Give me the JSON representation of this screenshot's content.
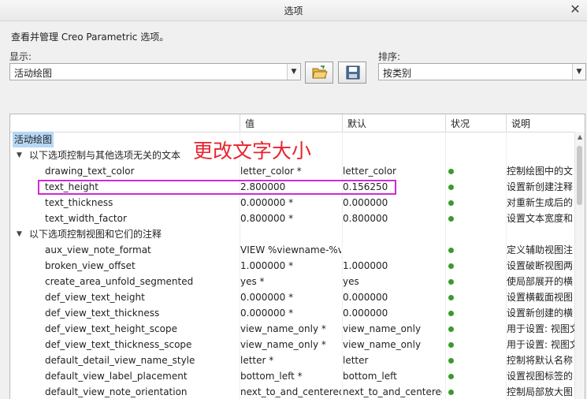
{
  "dialog": {
    "title": "选项",
    "close_glyph": "✕",
    "description": "查看并管理 Creo Parametric 选项。"
  },
  "display": {
    "label": "显示:",
    "value": "活动绘图",
    "arrow": "▼"
  },
  "sort": {
    "label": "排序:",
    "value": "按类别",
    "arrow": "▼"
  },
  "buttons": {
    "open_icon": "folder-open-icon",
    "save_icon": "save-disk-icon"
  },
  "table": {
    "headers": {
      "name": "",
      "value": "值",
      "default": "默认",
      "status": "状况",
      "description": "说明"
    },
    "category": "活动绘图",
    "groups": [
      {
        "label": "以下选项控制与其他选项无关的文本",
        "rows": [
          {
            "name": "drawing_text_color",
            "value": "letter_color *",
            "default": "letter_color",
            "desc": "控制绘图中的文"
          },
          {
            "name": "text_height",
            "value": "2.800000",
            "default": "0.156250",
            "desc": "设置新创建注释"
          },
          {
            "name": "text_thickness",
            "value": "0.000000 *",
            "default": "0.000000",
            "desc": "对重新生成后的"
          },
          {
            "name": "text_width_factor",
            "value": "0.800000 *",
            "default": "0.800000",
            "desc": "设置文本宽度和"
          }
        ]
      },
      {
        "label": "以下选项控制视图和它们的注释",
        "rows": [
          {
            "name": "aux_view_note_format",
            "value": "VIEW %viewname-%vi",
            "default": "",
            "desc": "定义辅助视图注"
          },
          {
            "name": "broken_view_offset",
            "value": "1.000000 *",
            "default": "1.000000",
            "desc": "设置破断视图两"
          },
          {
            "name": "create_area_unfold_segmented",
            "value": "yes *",
            "default": "yes",
            "desc": "使局部展开的横"
          },
          {
            "name": "def_view_text_height",
            "value": "0.000000 *",
            "default": "0.000000",
            "desc": "设置横截面视图"
          },
          {
            "name": "def_view_text_thickness",
            "value": "0.000000 *",
            "default": "0.000000",
            "desc": "设置新创建的横"
          },
          {
            "name": "def_view_text_height_scope",
            "value": "view_name_only *",
            "default": "view_name_only",
            "desc": "用于设置: 视图文"
          },
          {
            "name": "def_view_text_thickness_scope",
            "value": "view_name_only *",
            "default": "view_name_only",
            "desc": "用于设置: 视图文"
          },
          {
            "name": "default_detail_view_name_style",
            "value": "letter *",
            "default": "letter",
            "desc": "控制将默认名称"
          },
          {
            "name": "default_view_label_placement",
            "value": "bottom_left *",
            "default": "bottom_left",
            "desc": "设置视图标签的"
          },
          {
            "name": "default_view_note_orientation",
            "value": "next_to_and_centered",
            "default": "next_to_and_centered",
            "desc": "控制局部放大图"
          }
        ]
      }
    ]
  },
  "annotation": {
    "text": "更改文字大小",
    "color": "#e8232e",
    "highlight_color": "#cf2ad2"
  },
  "colors": {
    "status_ok": "#3a9a2e",
    "selection": "#b7d7f5"
  }
}
